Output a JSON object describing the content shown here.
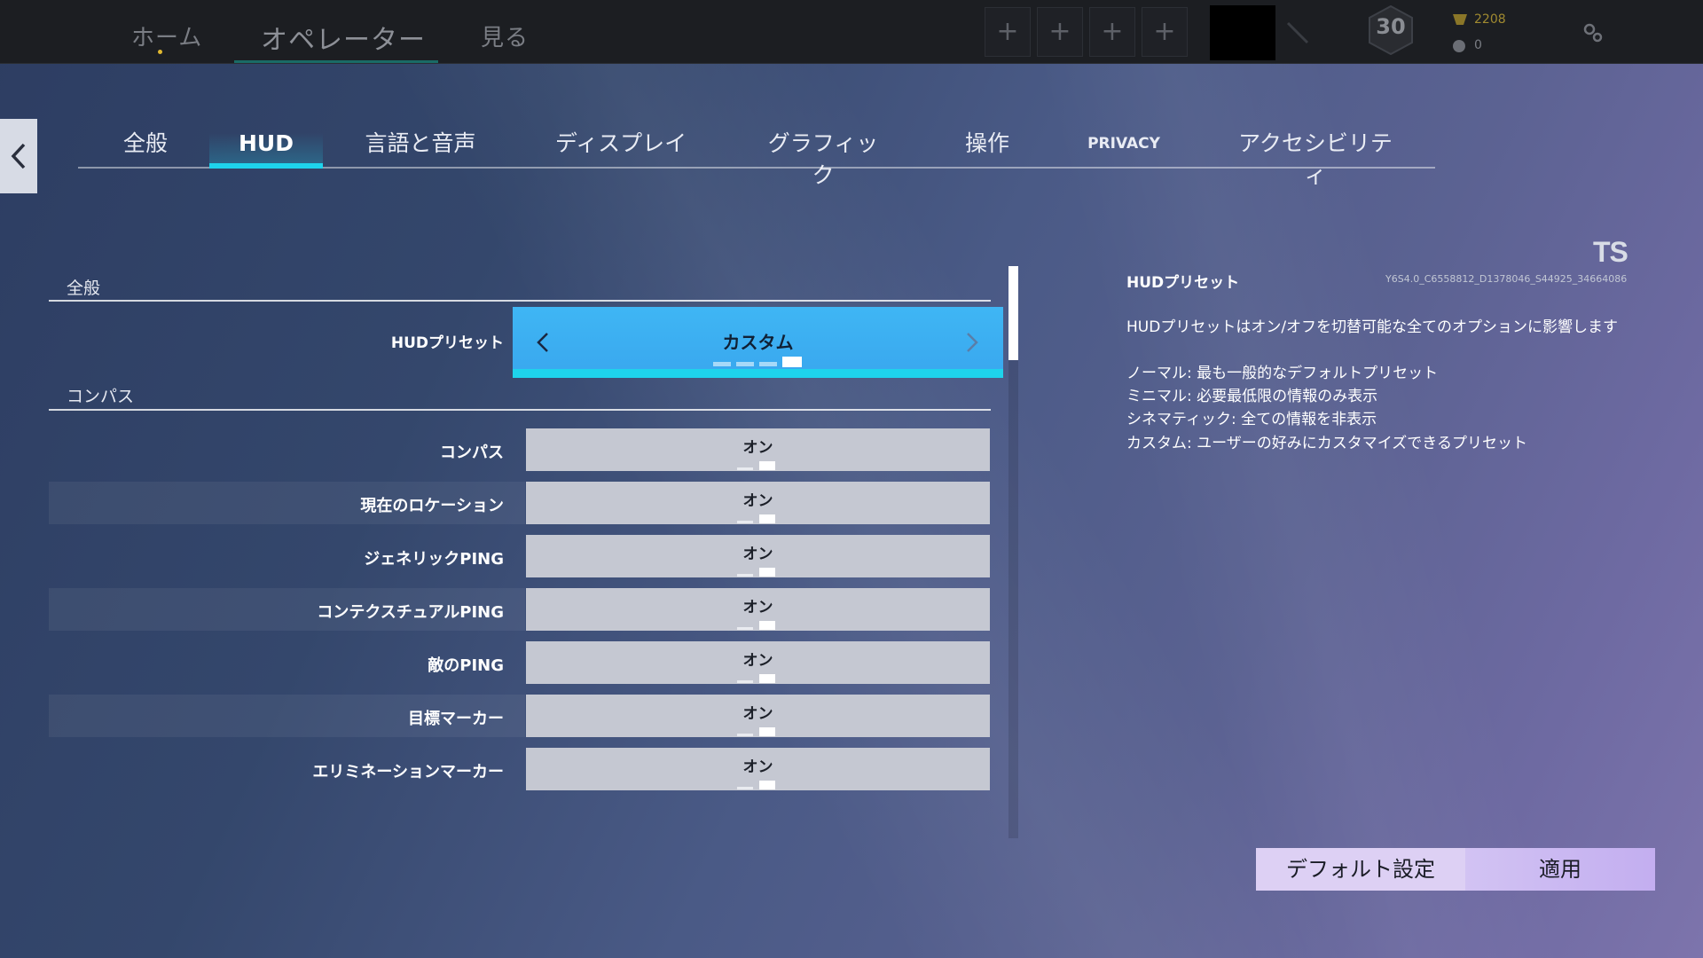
{
  "topbar": {
    "nav": [
      "ホーム",
      "オペレーター",
      "見る"
    ],
    "plus_slots": [
      "+",
      "+",
      "+",
      "+"
    ],
    "level": "30",
    "currency_primary": "2208",
    "currency_secondary": "0"
  },
  "tabs": [
    "全般",
    "HUD",
    "言語と音声",
    "ディスプレイ",
    "グラフィック",
    "操作",
    "PRIVACY",
    "アクセシビリティ"
  ],
  "active_tab": "HUD",
  "sections": {
    "general_title": "全般",
    "compass_title": "コンパス"
  },
  "preset": {
    "label": "HUDプリセット",
    "value": "カスタム",
    "options_count": 4,
    "active_index": 3
  },
  "rows": [
    {
      "label": "コンパス",
      "value": "オン"
    },
    {
      "label": "現在のロケーション",
      "value": "オン"
    },
    {
      "label": "ジェネリックPING",
      "value": "オン"
    },
    {
      "label": "コンテクスチュアルPING",
      "value": "オン"
    },
    {
      "label": "敵のPING",
      "value": "オン"
    },
    {
      "label": "目標マーカー",
      "value": "オン"
    },
    {
      "label": "エリミネーションマーカー",
      "value": "オン"
    }
  ],
  "info": {
    "logo": "TS",
    "title": "HUDプリセット",
    "build_id": "Y6S4.0_C6558812_D1378046_S44925_34664086",
    "description": "HUDプリセットはオン/オフを切替可能な全てのオプションに影響します",
    "lines": [
      "ノーマル: 最も一般的なデフォルトプリセット",
      "ミニマル: 必要最低限の情報のみ表示",
      "シネマティック: 全ての情報を非表示",
      "カスタム: ユーザーの好みにカスタマイズできるプリセット"
    ]
  },
  "buttons": {
    "default": "デフォルト設定",
    "apply": "適用"
  },
  "colors": {
    "accent": "#1ed3ec",
    "preset_bg": "#3fb6f4",
    "control_bg": "#c5c8d2",
    "button_bg": "#ddd0f4"
  }
}
